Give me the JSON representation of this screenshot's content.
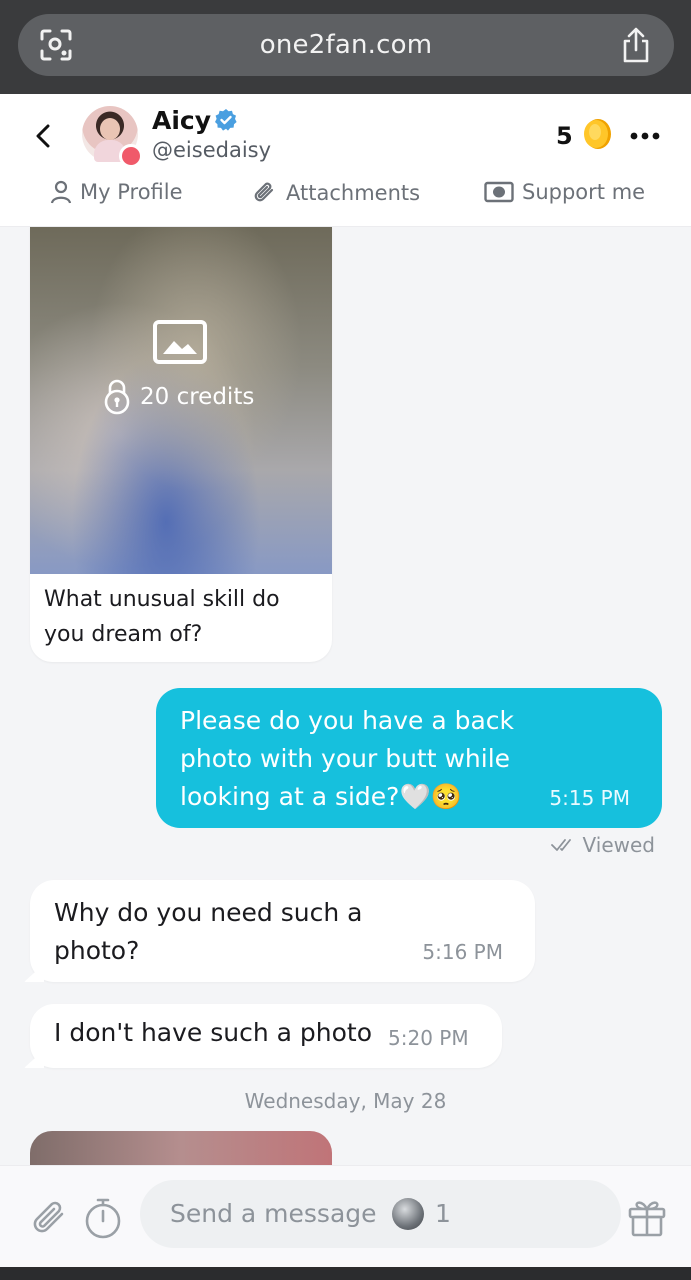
{
  "browser": {
    "url": "one2fan.com"
  },
  "header": {
    "name": "Aicy",
    "handle": "@eisedaisy",
    "coins": "5"
  },
  "tabs": [
    {
      "label": "My Profile",
      "icon": "person-icon"
    },
    {
      "label": "Attachments",
      "icon": "paperclip-icon"
    },
    {
      "label": "Support me",
      "icon": "cash-icon"
    }
  ],
  "messages": {
    "locked_media": {
      "price": "20 credits",
      "caption": "What unusual skill do you dream of?"
    },
    "outgoing_1": {
      "text": "Please do you have a back photo with your butt while looking at a side?🤍🥺",
      "time": "5:15 PM",
      "status": "Viewed"
    },
    "incoming_1": {
      "text": "Why do you need such a photo?",
      "time": "5:16 PM"
    },
    "incoming_2": {
      "text": "I don't have such a photo",
      "time": "5:20 PM"
    },
    "date_separator": "Wednesday, May 28"
  },
  "composer": {
    "placeholder": "Send a message",
    "price": "1"
  },
  "colors": {
    "accent": "#16c0dd",
    "coin": "#f5b800",
    "online_status": "#f05a6a"
  }
}
